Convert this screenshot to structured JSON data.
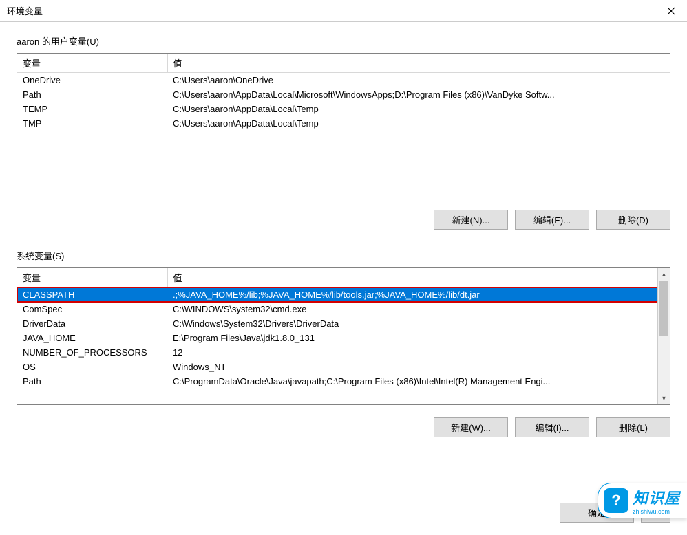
{
  "window_title": "环境变量",
  "user_section": {
    "label": "aaron 的用户变量(U)",
    "headers": {
      "var": "变量",
      "val": "值"
    },
    "rows": [
      {
        "var": "OneDrive",
        "val": "C:\\Users\\aaron\\OneDrive"
      },
      {
        "var": "Path",
        "val": "C:\\Users\\aaron\\AppData\\Local\\Microsoft\\WindowsApps;D:\\Program Files (x86)\\VanDyke Softw..."
      },
      {
        "var": "TEMP",
        "val": "C:\\Users\\aaron\\AppData\\Local\\Temp"
      },
      {
        "var": "TMP",
        "val": "C:\\Users\\aaron\\AppData\\Local\\Temp"
      }
    ],
    "buttons": {
      "new": "新建(N)...",
      "edit": "编辑(E)...",
      "delete": "删除(D)"
    }
  },
  "sys_section": {
    "label": "系统变量(S)",
    "headers": {
      "var": "变量",
      "val": "值"
    },
    "rows": [
      {
        "var": "CLASSPATH",
        "val": ".;%JAVA_HOME%/lib;%JAVA_HOME%/lib/tools.jar;%JAVA_HOME%/lib/dt.jar",
        "selected": true
      },
      {
        "var": "ComSpec",
        "val": "C:\\WINDOWS\\system32\\cmd.exe"
      },
      {
        "var": "DriverData",
        "val": "C:\\Windows\\System32\\Drivers\\DriverData"
      },
      {
        "var": "JAVA_HOME",
        "val": "E:\\Program Files\\Java\\jdk1.8.0_131"
      },
      {
        "var": "NUMBER_OF_PROCESSORS",
        "val": "12"
      },
      {
        "var": "OS",
        "val": "Windows_NT"
      },
      {
        "var": "Path",
        "val": "C:\\ProgramData\\Oracle\\Java\\javapath;C:\\Program Files (x86)\\Intel\\Intel(R) Management Engi..."
      }
    ],
    "buttons": {
      "new": "新建(W)...",
      "edit": "编辑(I)...",
      "delete": "删除(L)"
    }
  },
  "dialog_buttons": {
    "ok": "确定",
    "cancel": "取"
  },
  "watermark": {
    "text": "知识屋",
    "sub": "zhishiwu.com"
  }
}
